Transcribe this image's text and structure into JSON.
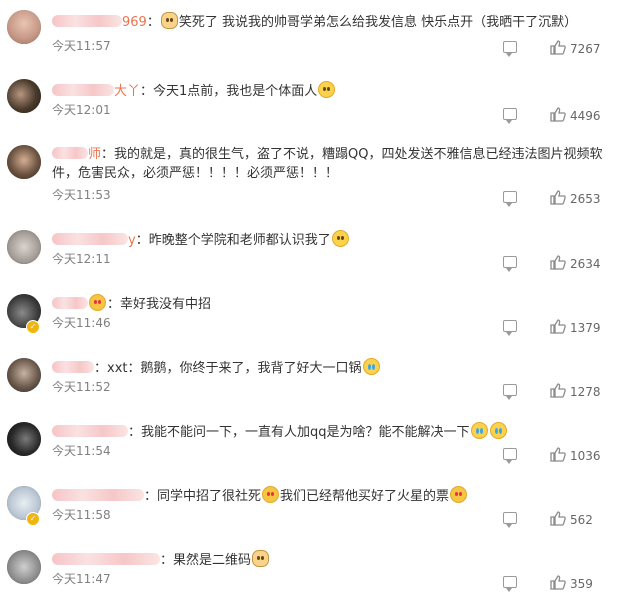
{
  "comments": [
    {
      "name_tail": "969",
      "text": "笑死了 我说我的帅哥学弟怎么给我发信息 快乐点开（我晒干了沉默）",
      "time": "今天11:57",
      "likes": "7267",
      "emoji": "dog",
      "emoji_pos": "start"
    },
    {
      "name_tail": "大丫",
      "text": "今天1点前，我也是个体面人",
      "time": "今天12:01",
      "likes": "4496",
      "emoji": "smile",
      "emoji_pos": "end"
    },
    {
      "name_tail": "师",
      "text": "我的就是，真的很生气，盗了不说，糟蹋QQ，四处发送不雅信息已经违法图片视频软件，危害民众，必须严惩！！！！必须严惩！！！",
      "time": "今天11:53",
      "likes": "2653",
      "emoji": "",
      "emoji_pos": ""
    },
    {
      "name_tail": "y",
      "text": "昨晚整个学院和老师都认识我了",
      "time": "今天12:11",
      "likes": "2634",
      "emoji": "smile",
      "emoji_pos": "end"
    },
    {
      "name_tail": "",
      "text": "幸好我没有中招",
      "time": "今天11:46",
      "likes": "1379",
      "emoji": "",
      "emoji_pos": ""
    },
    {
      "name_tail": "",
      "text": "xxt：鹅鹅，你终于来了，我背了好大一口锅",
      "time": "今天11:52",
      "likes": "1278",
      "emoji": "cry",
      "emoji_pos": "end"
    },
    {
      "name_tail": "",
      "text": "我能不能问一下，一直有人加qq是为啥？能不能解决一下",
      "time": "今天11:54",
      "likes": "1036",
      "emoji": "cry",
      "emoji_pos": "end2"
    },
    {
      "name_tail": "",
      "text_a": "同学中招了很社死",
      "text_b": "我们已经帮他买好了火星的票",
      "time": "今天11:58",
      "likes": "562",
      "emoji": "love",
      "emoji_pos": "both"
    },
    {
      "name_tail": "",
      "text": "果然是二维码",
      "time": "今天11:47",
      "likes": "359",
      "emoji": "dog",
      "emoji_pos": "end"
    }
  ]
}
